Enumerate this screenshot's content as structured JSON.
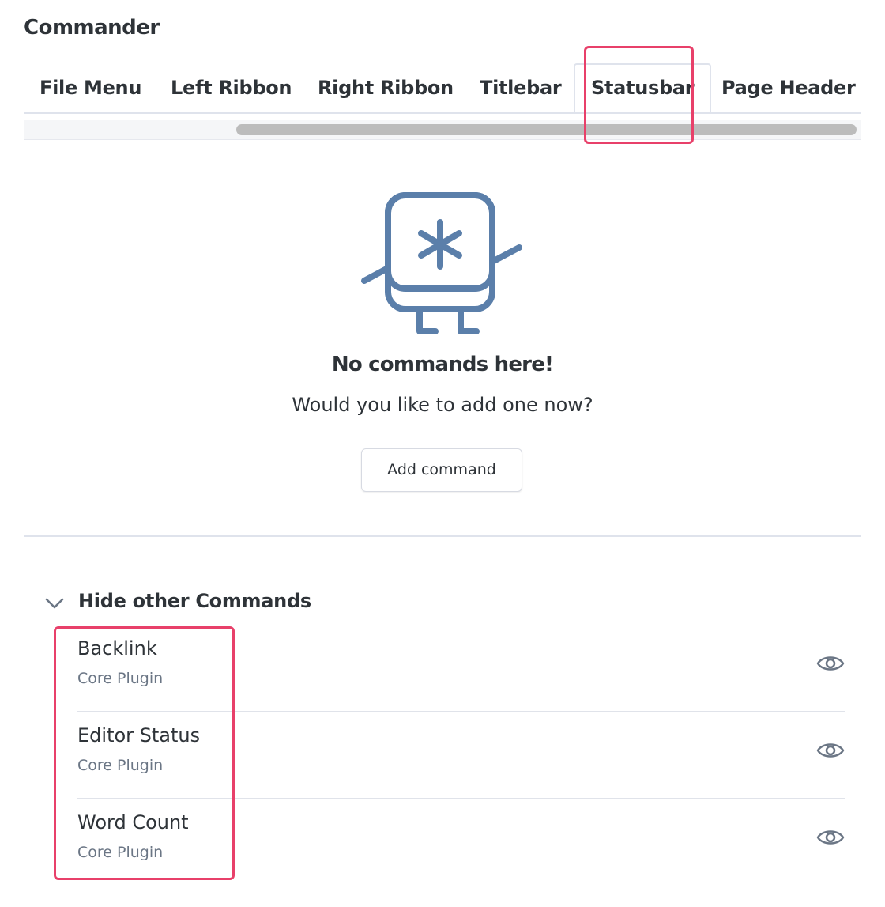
{
  "header": {
    "title": "Commander"
  },
  "tabs": [
    {
      "label": "File Menu",
      "active": false
    },
    {
      "label": "Left Ribbon",
      "active": false
    },
    {
      "label": "Right Ribbon",
      "active": false
    },
    {
      "label": "Titlebar",
      "active": false
    },
    {
      "label": "Statusbar",
      "active": true
    },
    {
      "label": "Page Header",
      "active": false
    }
  ],
  "empty_state": {
    "title": "No commands here!",
    "subtitle": "Would you like to add one now?",
    "add_button_label": "Add command",
    "mascot_icon": "asterisk-mascot-icon",
    "mascot_color": "#5b7faa"
  },
  "other_commands": {
    "toggle_label": "Hide other Commands",
    "toggle_icon": "chevron-down-icon",
    "items": [
      {
        "name": "Backlink",
        "source": "Core Plugin",
        "icon": "eye-icon"
      },
      {
        "name": "Editor Status",
        "source": "Core Plugin",
        "icon": "eye-icon"
      },
      {
        "name": "Word Count",
        "source": "Core Plugin",
        "icon": "eye-icon"
      }
    ]
  },
  "colors": {
    "highlight": "#e8406a",
    "text": "#2e3338",
    "muted": "#6b7685",
    "border": "#dfe3ec"
  }
}
